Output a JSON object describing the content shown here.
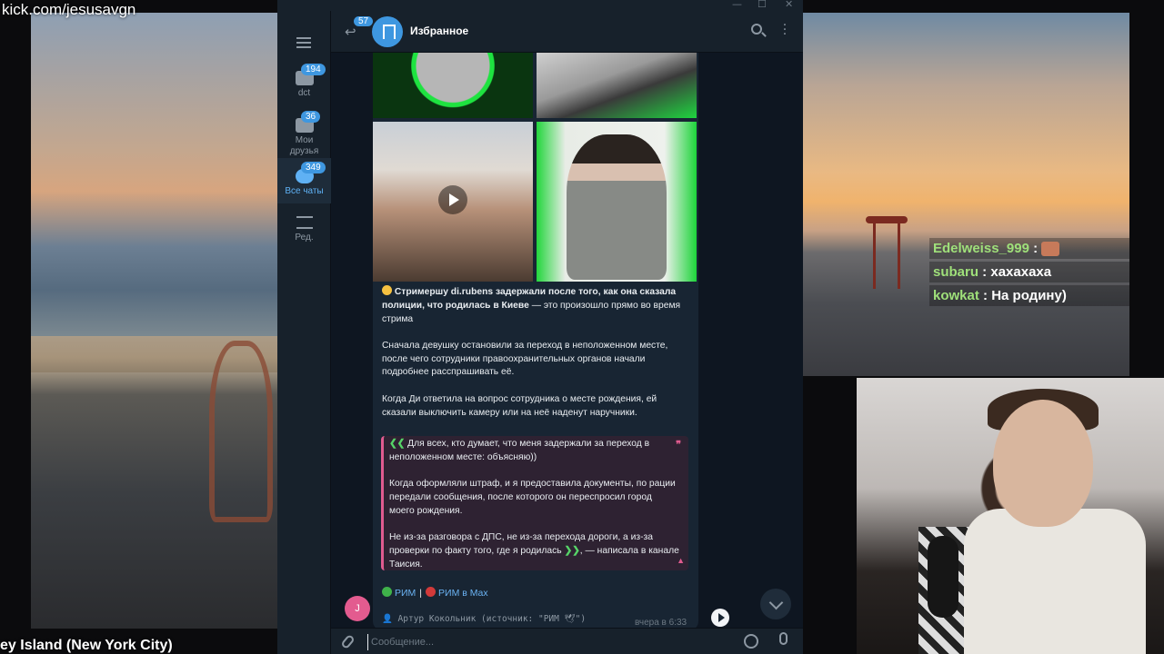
{
  "overlay": {
    "watermark": "kick.com/jesusavgn",
    "location": "ey Island (New York City)",
    "chat": [
      {
        "user": "Edelweiss_999",
        "sep": " :",
        "text": ""
      },
      {
        "user": "subaru",
        "sep": " : ",
        "text": "хахахаха"
      },
      {
        "user": "kowkat",
        "sep": " : ",
        "text": "На родину)"
      }
    ]
  },
  "telegram": {
    "header": {
      "back_badge": "57",
      "title": "Избранное"
    },
    "sidebar": {
      "items": [
        {
          "label": "dct",
          "badge": "194",
          "icon": "folder-icon"
        },
        {
          "label": "Мои друзья",
          "badge": "36",
          "icon": "folder-icon"
        },
        {
          "label": "Все чаты",
          "badge": "349",
          "icon": "chats-icon",
          "active": true
        },
        {
          "label": "Ред.",
          "badge": "",
          "icon": "sliders-icon"
        }
      ]
    },
    "message": {
      "p1_bold": "Стримершу di.rubens задержали после того, как она сказала полиции, что родилась в Киеве",
      "p1_rest": " — это произошло прямо во время стрима",
      "p2": "Сначала девушку остановили за переход в неположенном месте, после чего сотрудники правоохранительных органов начали подробнее расспрашивать её.",
      "p3": "Когда Ди ответила на вопрос сотрудника о месте рождения, ей сказали выключить камеру или на неё наденут наручники.",
      "quote": {
        "open_mark": "❮❮",
        "q1": " Для всех, кто думает, что меня задержали за переход в неположенном месте: объясняю))",
        "q2": "Когда оформляли штраф, и я предоставила документы, по рации передали сообщения, после которого он переспросил город моего рождения.",
        "q3": "Не из-за разговора с ДПС, не из-за перехода дороги, а из-за проверки по факту того, где я родилась ",
        "close_mark": "❯❯",
        "q3_tail": ", — написала в канале Таисия.",
        "end_mark": "❞"
      },
      "link1": "РИМ",
      "link_sep": "|",
      "link2": "РИМ в Max",
      "author": "👤 Артур Кокольник (источник: \"РИМ 🕊\")",
      "time": "вчера в 6:33"
    },
    "sender_initial": "J",
    "composer": {
      "placeholder": "Сообщение..."
    }
  },
  "colors": {
    "tg_bg": "#0e1621",
    "tg_panel": "#17212b",
    "bubble": "#182533",
    "accent": "#3e97e0",
    "quote_border": "#e05b8f",
    "link": "#6ab2f2"
  }
}
